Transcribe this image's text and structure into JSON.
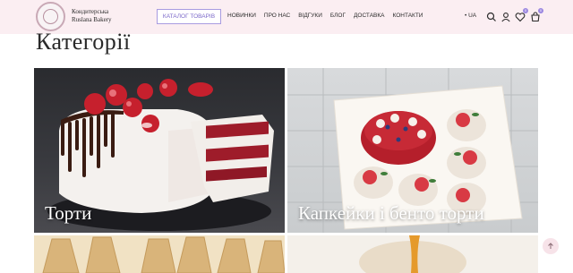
{
  "header": {
    "logo_line1": "Кондитерська",
    "logo_line2": "Ruslana Bakery",
    "catalog_label": "КАТАЛОГ ТОВАРІВ",
    "nav": [
      "НОВИНКИ",
      "ПРО НАС",
      "ВІДГУКИ",
      "БЛОГ",
      "ДОСТАВКА",
      "КОНТАКТИ"
    ],
    "lang": "• UA",
    "wishlist_count": "0",
    "cart_count": "0"
  },
  "main": {
    "title": "Категорії",
    "categories": [
      {
        "label": "Торти"
      },
      {
        "label": "Капкейки і бенто торти"
      }
    ]
  },
  "colors": {
    "header_bg": "#fbeef2",
    "accent": "#7b68c9",
    "badge": "#9b87e0"
  }
}
